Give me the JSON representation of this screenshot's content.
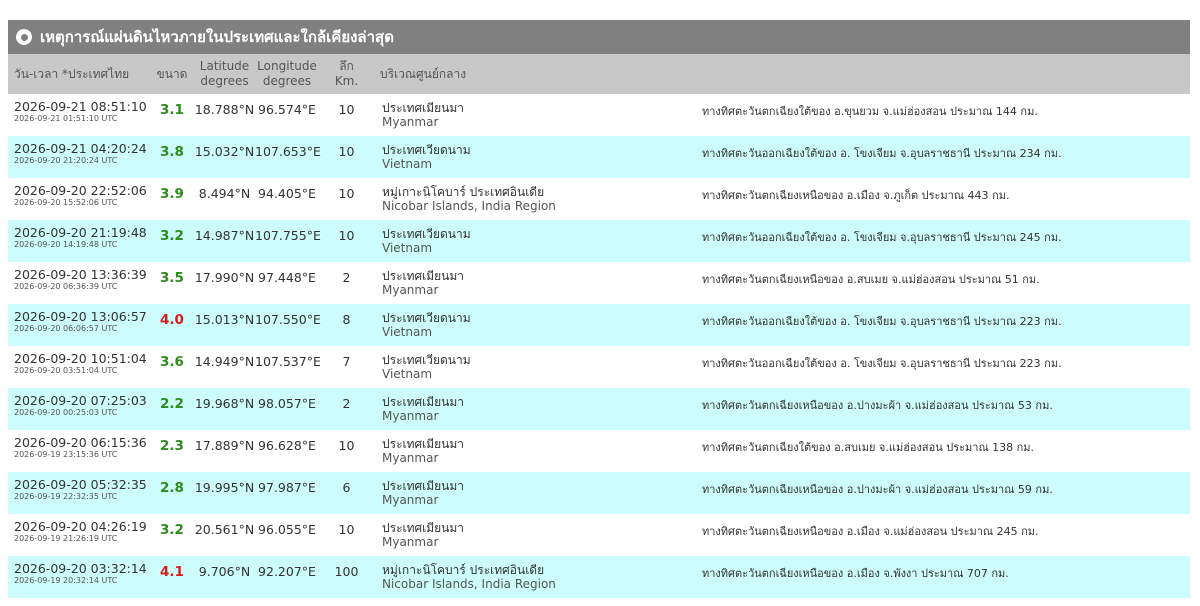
{
  "panel": {
    "title": "เหตุการณ์แผ่นดินไหวภายในประเทศและใกล้เคียงล่าสุด"
  },
  "columns": {
    "datetime": "วัน-เวลา *ประเทศไทย",
    "magnitude": "ขนาด",
    "latitude_1": "Latitude",
    "latitude_2": "degrees",
    "longitude_1": "Longitude",
    "longitude_2": "degrees",
    "depth_1": "ลึก",
    "depth_2": "Km.",
    "region": "บริเวณศูนย์กลาง"
  },
  "colors": {
    "title_bar": "#808080",
    "header_bg": "#c8c8c8",
    "row_alt": "#ccfcfc",
    "mag_normal": "#2e8b1e",
    "mag_high": "#d81c1c"
  },
  "rows": [
    {
      "th_time": "2026-09-21 08:51:10",
      "utc_time": "2026-09-21 01:51:10 UTC",
      "mag": "3.1",
      "level": "green",
      "lat": "18.788°N",
      "lon": "96.574°E",
      "depth": "10",
      "region_th": "ประเทศเมียนมา",
      "region_en": "Myanmar",
      "desc": "ทางทิศตะวันตกเฉียงใต้ของ อ.ขุนยวม จ.แม่ฮ่องสอน ประมาณ 144 กม."
    },
    {
      "th_time": "2026-09-21 04:20:24",
      "utc_time": "2026-09-20 21:20:24 UTC",
      "mag": "3.8",
      "level": "green",
      "lat": "15.032°N",
      "lon": "107.653°E",
      "depth": "10",
      "region_th": "ประเทศเวียดนาม",
      "region_en": "Vietnam",
      "desc": "ทางทิศตะวันออกเฉียงใต้ของ อ. โขงเจียม จ.อุบลราชธานี ประมาณ 234 กม."
    },
    {
      "th_time": "2026-09-20 22:52:06",
      "utc_time": "2026-09-20 15:52:06 UTC",
      "mag": "3.9",
      "level": "green",
      "lat": "8.494°N",
      "lon": "94.405°E",
      "depth": "10",
      "region_th": "หมู่เกาะนิโคบาร์ ประเทศอินเดีย",
      "region_en": "Nicobar Islands, India Region",
      "desc": "ทางทิศตะวันตกเฉียงเหนือของ อ.เมือง จ.ภูเก็ต ประมาณ 443 กม."
    },
    {
      "th_time": "2026-09-20 21:19:48",
      "utc_time": "2026-09-20 14:19:48 UTC",
      "mag": "3.2",
      "level": "green",
      "lat": "14.987°N",
      "lon": "107.755°E",
      "depth": "10",
      "region_th": "ประเทศเวียดนาม",
      "region_en": "Vietnam",
      "desc": "ทางทิศตะวันออกเฉียงใต้ของ อ. โขงเจียม จ.อุบลราชธานี ประมาณ 245 กม."
    },
    {
      "th_time": "2026-09-20 13:36:39",
      "utc_time": "2026-09-20 06:36:39 UTC",
      "mag": "3.5",
      "level": "green",
      "lat": "17.990°N",
      "lon": "97.448°E",
      "depth": "2",
      "region_th": "ประเทศเมียนมา",
      "region_en": "Myanmar",
      "desc": "ทางทิศตะวันตกเฉียงเหนือของ อ.สบเมย จ.แม่ฮ่องสอน ประมาณ 51 กม."
    },
    {
      "th_time": "2026-09-20 13:06:57",
      "utc_time": "2026-09-20 06:06:57 UTC",
      "mag": "4.0",
      "level": "red",
      "lat": "15.013°N",
      "lon": "107.550°E",
      "depth": "8",
      "region_th": "ประเทศเวียดนาม",
      "region_en": "Vietnam",
      "desc": "ทางทิศตะวันออกเฉียงใต้ของ อ. โขงเจียม จ.อุบลราชธานี ประมาณ 223 กม."
    },
    {
      "th_time": "2026-09-20 10:51:04",
      "utc_time": "2026-09-20 03:51:04 UTC",
      "mag": "3.6",
      "level": "green",
      "lat": "14.949°N",
      "lon": "107.537°E",
      "depth": "7",
      "region_th": "ประเทศเวียดนาม",
      "region_en": "Vietnam",
      "desc": "ทางทิศตะวันออกเฉียงใต้ของ อ. โขงเจียม จ.อุบลราชธานี ประมาณ 223 กม."
    },
    {
      "th_time": "2026-09-20 07:25:03",
      "utc_time": "2026-09-20 00:25:03 UTC",
      "mag": "2.2",
      "level": "green",
      "lat": "19.968°N",
      "lon": "98.057°E",
      "depth": "2",
      "region_th": "ประเทศเมียนมา",
      "region_en": "Myanmar",
      "desc": "ทางทิศตะวันตกเฉียงเหนือของ อ.ปางมะผ้า จ.แม่ฮ่องสอน ประมาณ 53 กม."
    },
    {
      "th_time": "2026-09-20 06:15:36",
      "utc_time": "2026-09-19 23:15:36 UTC",
      "mag": "2.3",
      "level": "green",
      "lat": "17.889°N",
      "lon": "96.628°E",
      "depth": "10",
      "region_th": "ประเทศเมียนมา",
      "region_en": "Myanmar",
      "desc": "ทางทิศตะวันตกเฉียงใต้ของ อ.สบเมย จ.แม่ฮ่องสอน ประมาณ 138 กม."
    },
    {
      "th_time": "2026-09-20 05:32:35",
      "utc_time": "2026-09-19 22:32:35 UTC",
      "mag": "2.8",
      "level": "green",
      "lat": "19.995°N",
      "lon": "97.987°E",
      "depth": "6",
      "region_th": "ประเทศเมียนมา",
      "region_en": "Myanmar",
      "desc": "ทางทิศตะวันตกเฉียงเหนือของ อ.ปางมะผ้า จ.แม่ฮ่องสอน ประมาณ 59 กม."
    },
    {
      "th_time": "2026-09-20 04:26:19",
      "utc_time": "2026-09-19 21:26:19 UTC",
      "mag": "3.2",
      "level": "green",
      "lat": "20.561°N",
      "lon": "96.055°E",
      "depth": "10",
      "region_th": "ประเทศเมียนมา",
      "region_en": "Myanmar",
      "desc": "ทางทิศตะวันตกเฉียงเหนือของ อ.เมือง จ.แม่ฮ่องสอน ประมาณ 245 กม."
    },
    {
      "th_time": "2026-09-20 03:32:14",
      "utc_time": "2026-09-19 20:32:14 UTC",
      "mag": "4.1",
      "level": "red",
      "lat": "9.706°N",
      "lon": "92.207°E",
      "depth": "100",
      "region_th": "หมู่เกาะนิโคบาร์ ประเทศอินเดีย",
      "region_en": "Nicobar Islands, India Region",
      "desc": "ทางทิศตะวันตกเฉียงเหนือของ อ.เมือง จ.พังงา ประมาณ 707 กม."
    }
  ]
}
